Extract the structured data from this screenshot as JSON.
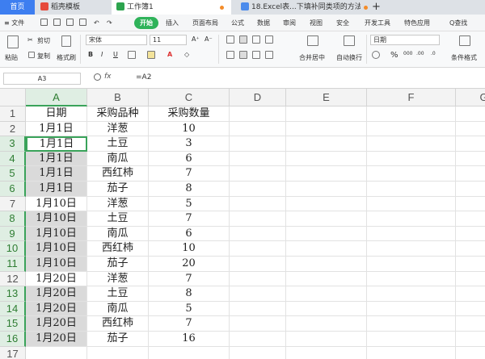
{
  "titlebar": {
    "home_tab": "首页",
    "template_tab": "稻壳模板",
    "workbook_tab": "工作簿1",
    "doc_tab": "18.Excel表...下填补同类项的方法",
    "new_tab": "+"
  },
  "menubar": {
    "file": "≡ 文件",
    "start": "开始",
    "items": [
      "插入",
      "页面布局",
      "公式",
      "数据",
      "审阅",
      "视图",
      "安全",
      "开发工具",
      "特色应用"
    ],
    "search": "Q查找"
  },
  "ribbon": {
    "paste": "粘贴",
    "cut": "剪切",
    "copy": "复制",
    "format_painter": "格式刷",
    "font_name": "宋体",
    "font_size": "11",
    "merge_center": "合并居中",
    "wrap_text": "自动换行",
    "number_format": "日期",
    "percent": "%",
    "conditional_format": "条件格式",
    "bold": "B",
    "italic": "I",
    "underline": "U",
    "grow_font": "A⁺",
    "shrink_font": "A⁻"
  },
  "formulabar": {
    "namebox": "A3",
    "fx": "fx",
    "formula": "=A2"
  },
  "sheet": {
    "columns": [
      "A",
      "B",
      "C",
      "D",
      "E",
      "F",
      "G"
    ],
    "rows": [
      "1",
      "2",
      "3",
      "4",
      "5",
      "6",
      "7",
      "8",
      "9",
      "10",
      "11",
      "12",
      "13",
      "14",
      "15",
      "16",
      "17"
    ],
    "data": [
      [
        "日期",
        "采购品种",
        "采购数量"
      ],
      [
        "1月1日",
        "洋葱",
        "10"
      ],
      [
        "1月1日",
        "土豆",
        "3"
      ],
      [
        "1月1日",
        "南瓜",
        "6"
      ],
      [
        "1月1日",
        "西红柿",
        "7"
      ],
      [
        "1月1日",
        "茄子",
        "8"
      ],
      [
        "1月10日",
        "洋葱",
        "5"
      ],
      [
        "1月10日",
        "土豆",
        "7"
      ],
      [
        "1月10日",
        "南瓜",
        "6"
      ],
      [
        "1月10日",
        "西红柿",
        "10"
      ],
      [
        "1月10日",
        "茄子",
        "20"
      ],
      [
        "1月20日",
        "洋葱",
        "7"
      ],
      [
        "1月20日",
        "土豆",
        "8"
      ],
      [
        "1月20日",
        "南瓜",
        "5"
      ],
      [
        "1月20日",
        "西红柿",
        "7"
      ],
      [
        "1月20日",
        "茄子",
        "16"
      ],
      [
        "",
        "",
        ""
      ]
    ],
    "selected_rows": [
      3,
      4,
      5,
      6,
      8,
      9,
      10,
      11,
      13,
      14,
      15,
      16
    ],
    "active_cell": "A3"
  },
  "colors": {
    "accent": "#3aa35a",
    "home_tab": "#3d7ef0",
    "selection": "#dadada"
  }
}
